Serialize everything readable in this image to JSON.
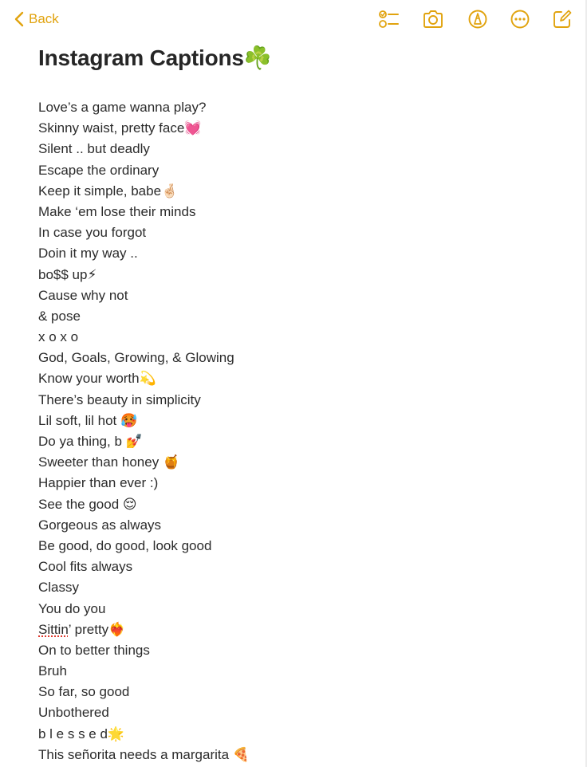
{
  "toolbar": {
    "back_label": "Back",
    "accent_color": "#E1A30E",
    "icons": [
      "checklist-icon",
      "camera-icon",
      "markup-icon",
      "more-icon",
      "compose-icon"
    ]
  },
  "note": {
    "title": "Instagram Captions☘️",
    "lines": [
      "Love’s a game wanna play?",
      "Skinny waist, pretty face💓",
      "Silent .. but deadly",
      "Escape the ordinary",
      "Keep it simple, babe🤞🏻",
      "Make ‘em lose their minds",
      "In case you forgot",
      "Doin it my way ..",
      "bo$$ up⚡",
      "Cause why not",
      "& pose",
      "x o x o",
      "God, Goals, Growing, & Glowing",
      "Know your worth💫",
      "There’s beauty in simplicity",
      "Lil soft, lil hot 🥵",
      "Do ya thing, b 💅",
      "Sweeter than honey 🍯",
      "Happier than ever :)",
      "See the good 😌",
      "Gorgeous as always",
      "Be good, do good, look good",
      "Cool fits always",
      "Classy",
      "You do you",
      {
        "misspelled": "Sittin",
        "rest": "’ pretty❤️‍🔥"
      },
      "On to better things",
      "Bruh",
      "So far, so good",
      "Unbothered",
      "b l e s s e d🌟",
      "This señorita needs a margarita 🍕"
    ]
  }
}
